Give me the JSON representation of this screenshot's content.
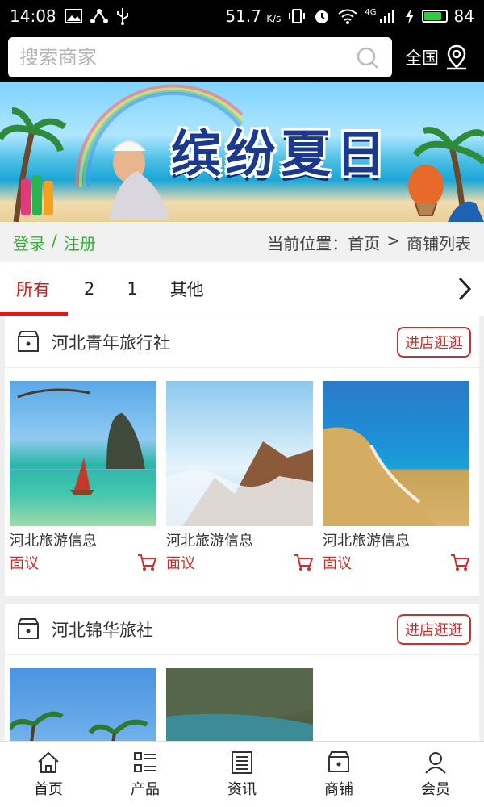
{
  "status_bar": {
    "time": "14:08",
    "net_speed": "51.7",
    "net_speed_unit": "K/s",
    "network": "4G",
    "battery_level": "84",
    "battery_fraction": 0.84
  },
  "header": {
    "search_placeholder": "搜索商家",
    "region_label": "全国"
  },
  "banner": {
    "title": "缤纷夏日"
  },
  "breadcrumb": {
    "login": "登录",
    "separator": "/",
    "register": "注册",
    "prefix": "当前位置：",
    "home": "首页",
    "arrow": ">",
    "current": "商铺列表"
  },
  "tabs": [
    {
      "label": "所有",
      "active": true
    },
    {
      "label": "2"
    },
    {
      "label": "1"
    },
    {
      "label": "其他"
    }
  ],
  "shops": [
    {
      "name": "河北青年旅行社",
      "enter_label": "进店逛逛",
      "products": [
        {
          "name": "河北旅游信息",
          "price": "面议"
        },
        {
          "name": "河北旅游信息",
          "price": "面议"
        },
        {
          "name": "河北旅游信息",
          "price": "面议"
        }
      ]
    },
    {
      "name": "河北锦华旅社",
      "enter_label": "进店逛逛",
      "products": []
    }
  ],
  "bottom_nav": [
    {
      "label": "首页",
      "icon": "home-icon"
    },
    {
      "label": "产品",
      "icon": "grid-list-icon"
    },
    {
      "label": "资讯",
      "icon": "news-icon"
    },
    {
      "label": "商铺",
      "icon": "store-icon"
    },
    {
      "label": "会员",
      "icon": "user-icon"
    }
  ],
  "colors": {
    "accent_red": "#d31c1c",
    "login_green": "#3aab3a"
  }
}
